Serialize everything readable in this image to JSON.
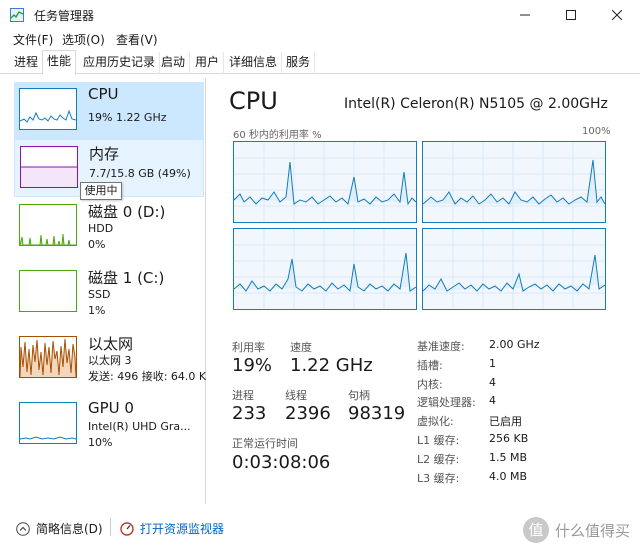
{
  "window": {
    "title": "任务管理器"
  },
  "menu": [
    "文件(F)",
    "选项(O)",
    "查看(V)"
  ],
  "tabs": [
    "进程",
    "性能",
    "应用历史记录",
    "启动",
    "用户",
    "详细信息",
    "服务"
  ],
  "active_tab": "性能",
  "resources": [
    {
      "name": "CPU",
      "sub1": "19% 1.22 GHz",
      "sub2": "",
      "color": "#117dbb"
    },
    {
      "name": "内存",
      "sub1": "7.7/15.8 GB (49%)",
      "sub2": "",
      "color": "#8b12ae"
    },
    {
      "name": "磁盘 0 (D:)",
      "sub1": "HDD",
      "sub2": "0%",
      "color": "#4da60c"
    },
    {
      "name": "磁盘 1 (C:)",
      "sub1": "SSD",
      "sub2": "1%",
      "color": "#4da60c"
    },
    {
      "name": "以太网",
      "sub1": "以太网 3",
      "sub2": "发送: 496  接收: 64.0 K",
      "color": "#a74f01"
    },
    {
      "name": "GPU 0",
      "sub1": "Intel(R) UHD Gra...",
      "sub2": "10%",
      "color": "#117dbb"
    }
  ],
  "tooltip": "使用中",
  "main": {
    "title": "CPU",
    "model": "Intel(R) Celeron(R) N5105 @ 2.00GHz",
    "axis_left": "60 秒内的利用率 %",
    "axis_right": "100%"
  },
  "stats": {
    "utilization_label": "利用率",
    "utilization": "19%",
    "speed_label": "速度",
    "speed": "1.22 GHz",
    "processes_label": "进程",
    "processes": "233",
    "threads_label": "线程",
    "threads": "2396",
    "handles_label": "句柄",
    "handles": "98319",
    "uptime_label": "正常运行时间",
    "uptime": "0:03:08:06"
  },
  "specs": [
    {
      "label": "基准速度:",
      "value": "2.00 GHz"
    },
    {
      "label": "插槽:",
      "value": "1"
    },
    {
      "label": "内核:",
      "value": "4"
    },
    {
      "label": "逻辑处理器:",
      "value": "4"
    },
    {
      "label": "虚拟化:",
      "value": "已启用"
    },
    {
      "label": "L1 缓存:",
      "value": "256 KB"
    },
    {
      "label": "L2 缓存:",
      "value": "1.5 MB"
    },
    {
      "label": "L3 缓存:",
      "value": "4.0 MB"
    }
  ],
  "footer": {
    "summary": "简略信息(D)",
    "monitor": "打开资源监视器"
  },
  "watermark": {
    "badge": "值",
    "text": "什么值得买"
  }
}
